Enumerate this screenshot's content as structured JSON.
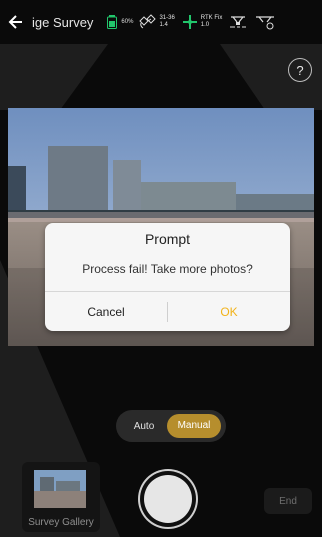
{
  "header": {
    "title": "ige Survey",
    "battery_percent": "60%",
    "satellite_top": "31-36",
    "satellite_bottom": "1.4",
    "rtk_top": "RTK Fix",
    "rtk_bottom": "1.0"
  },
  "help": {
    "label": "?"
  },
  "dialog": {
    "title": "Prompt",
    "message": "Process fail! Take more photos?",
    "cancel_label": "Cancel",
    "ok_label": "OK"
  },
  "mode_toggle": {
    "options": [
      "Auto",
      "Manual"
    ],
    "selected": "Manual"
  },
  "gallery": {
    "label": "Survey Gallery"
  },
  "controls": {
    "end_label": "End"
  },
  "colors": {
    "accent": "#f2b31a",
    "toggle_active": "#b68e2d",
    "status_green": "#21c66b"
  }
}
